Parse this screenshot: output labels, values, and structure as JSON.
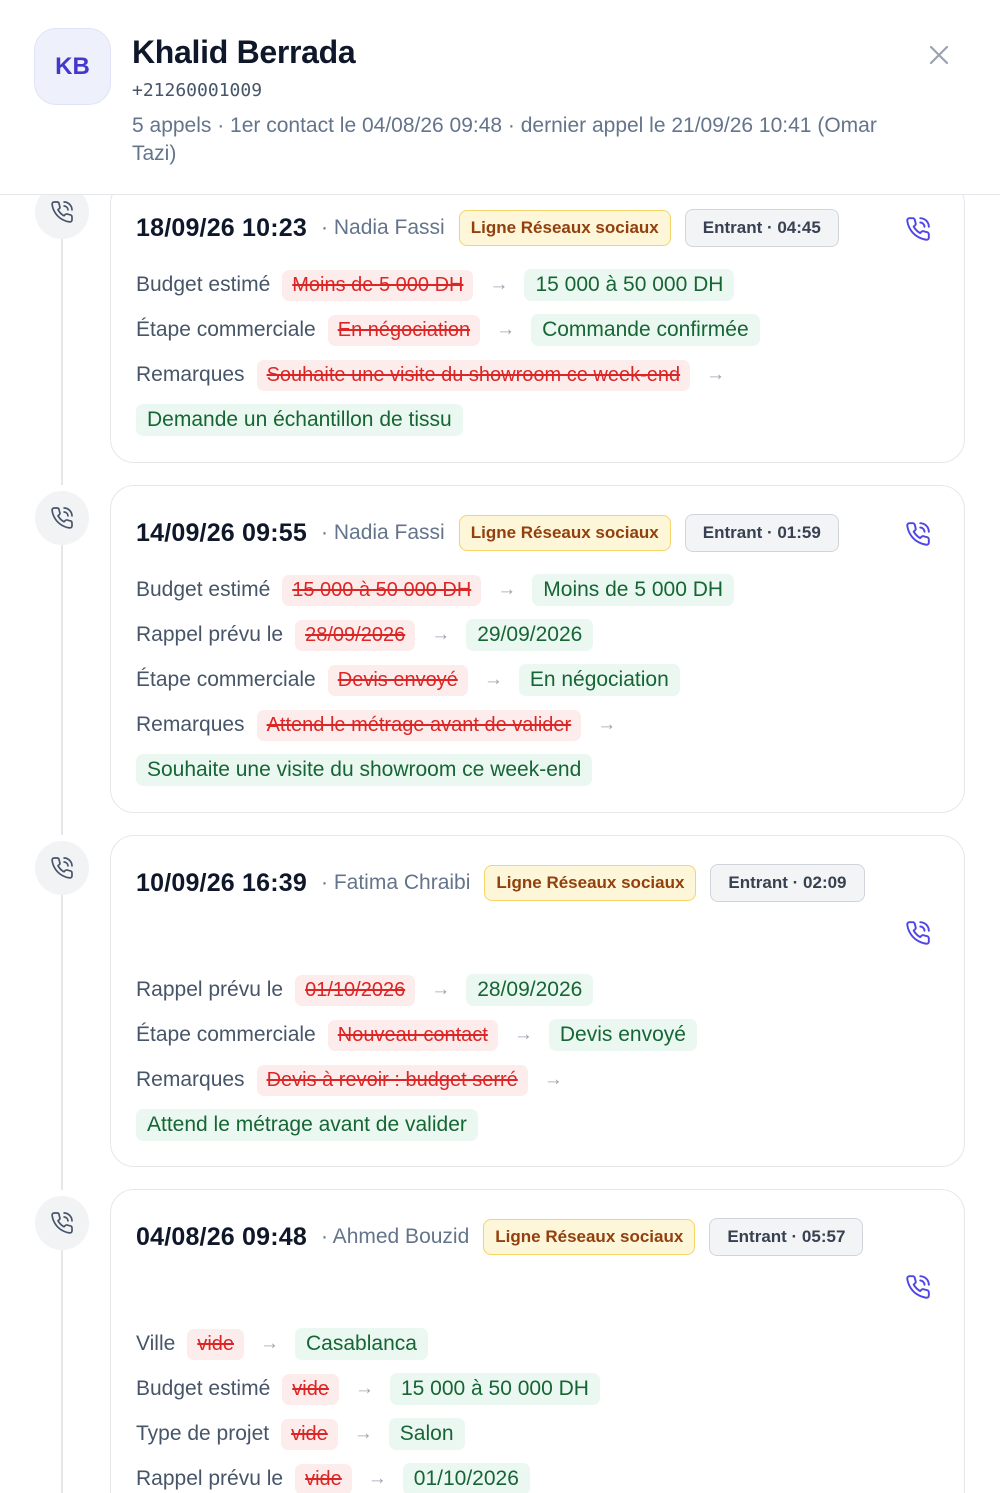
{
  "contact": {
    "initials": "KB",
    "name": "Khalid Berrada",
    "phone": "+21260001009",
    "summary": "5 appels · 1er contact le 04/08/26 09:48 · dernier appel le 21/09/26 10:41 (Omar Tazi)"
  },
  "calls": [
    {
      "date": "18/09/26 10:23",
      "agent": "· Nadia Fassi",
      "line": "Ligne Réseaux sociaux",
      "direction": "Entrant · 04:45",
      "changes": [
        {
          "field": "Budget estimé",
          "old": "Moins de 5 000 DH",
          "new": "15 000 à 50 000 DH"
        },
        {
          "field": "Étape commerciale",
          "old": "En négociation",
          "new": "Commande confirmée"
        },
        {
          "field": "Remarques",
          "old": "Souhaite une visite du showroom ce week-end",
          "new": "Demande un échantillon de tissu"
        }
      ]
    },
    {
      "date": "14/09/26 09:55",
      "agent": "· Nadia Fassi",
      "line": "Ligne Réseaux sociaux",
      "direction": "Entrant · 01:59",
      "changes": [
        {
          "field": "Budget estimé",
          "old": "15 000 à 50 000 DH",
          "new": "Moins de 5 000 DH"
        },
        {
          "field": "Rappel prévu le",
          "old": "28/09/2026",
          "new": "29/09/2026"
        },
        {
          "field": "Étape commerciale",
          "old": "Devis envoyé",
          "new": "En négociation"
        },
        {
          "field": "Remarques",
          "old": "Attend le métrage avant de valider",
          "new": "Souhaite une visite du showroom ce week-end"
        }
      ]
    },
    {
      "date": "10/09/26 16:39",
      "agent": "· Fatima Chraibi",
      "line": "Ligne Réseaux sociaux",
      "direction": "Entrant · 02:09",
      "changes": [
        {
          "field": "Rappel prévu le",
          "old": "01/10/2026",
          "new": "28/09/2026"
        },
        {
          "field": "Étape commerciale",
          "old": "Nouveau contact",
          "new": "Devis envoyé"
        },
        {
          "field": "Remarques",
          "old": "Devis à revoir : budget serré",
          "new": "Attend le métrage avant de valider"
        }
      ]
    },
    {
      "date": "04/08/26 09:48",
      "agent": "· Ahmed Bouzid",
      "line": "Ligne Réseaux sociaux",
      "direction": "Entrant · 05:57",
      "changes": [
        {
          "field": "Ville",
          "old": "vide",
          "new": "Casablanca"
        },
        {
          "field": "Budget estimé",
          "old": "vide",
          "new": "15 000 à 50 000 DH"
        },
        {
          "field": "Type de projet",
          "old": "vide",
          "new": "Salon"
        },
        {
          "field": "Rappel prévu le",
          "old": "vide",
          "new": "01/10/2026"
        }
      ]
    }
  ],
  "icons": {
    "close": "close-icon",
    "call": "phone-call-icon",
    "accent": "#4f46e5"
  }
}
